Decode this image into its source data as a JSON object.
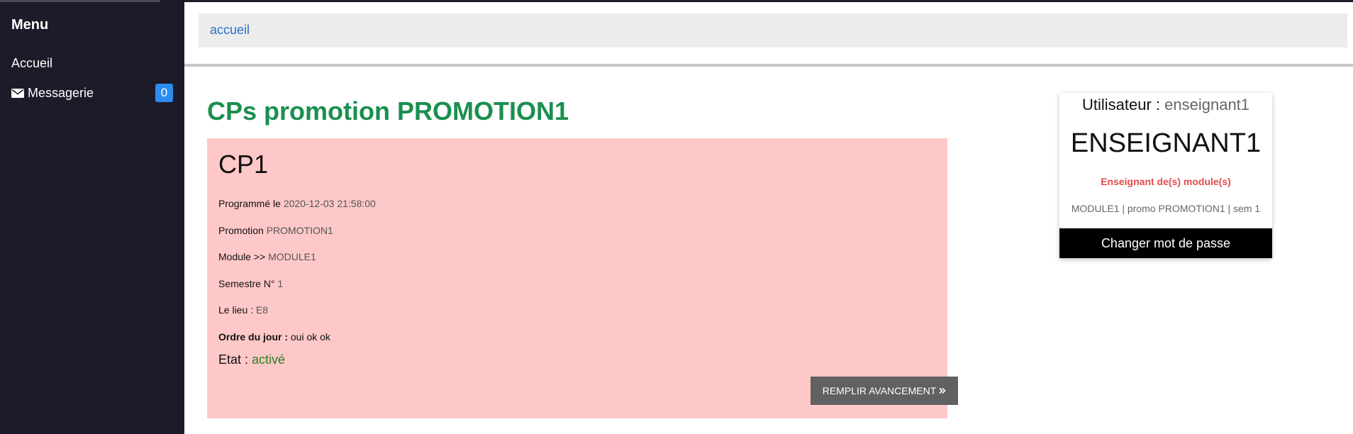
{
  "sidebar": {
    "menu_title": "Menu",
    "items": [
      {
        "label": "Accueil"
      },
      {
        "label": "Messagerie",
        "icon": "envelope-icon",
        "badge": "0"
      }
    ]
  },
  "breadcrumb": {
    "link": "accueil"
  },
  "page": {
    "title": "CPs promotion PROMOTION1"
  },
  "cp": {
    "name": "CP1",
    "scheduled_label": "Programmé le",
    "scheduled_value": "2020-12-03 21:58:00",
    "promotion_label": "Promotion",
    "promotion_value": "PROMOTION1",
    "module_label": "Module >>",
    "module_value": "MODULE1",
    "semester_label": "Semestre N°",
    "semester_value": "1",
    "place_label": "Le lieu :",
    "place_value": "E8",
    "agenda_label": "Ordre du jour :",
    "agenda_value": "oui ok ok",
    "state_label": "Etat :",
    "state_value": "activé",
    "fill_button": "REMPLIR AVANCEMENT"
  },
  "user_card": {
    "user_label": "Utilisateur :",
    "username": "enseignant1",
    "display_name": "ENSEIGNANT1",
    "role": "Enseignant de(s) module(s)",
    "module_line": "MODULE1 | promo PROMOTION1 | sem 1",
    "change_password": "Changer mot de passe"
  },
  "colors": {
    "sidebar_bg": "#1b1b29",
    "title_green": "#1a8f4f",
    "card_pink": "#fec8c8",
    "badge_blue": "#2d8cf0",
    "role_red": "#e44b4b",
    "state_green": "#2e7d22"
  }
}
